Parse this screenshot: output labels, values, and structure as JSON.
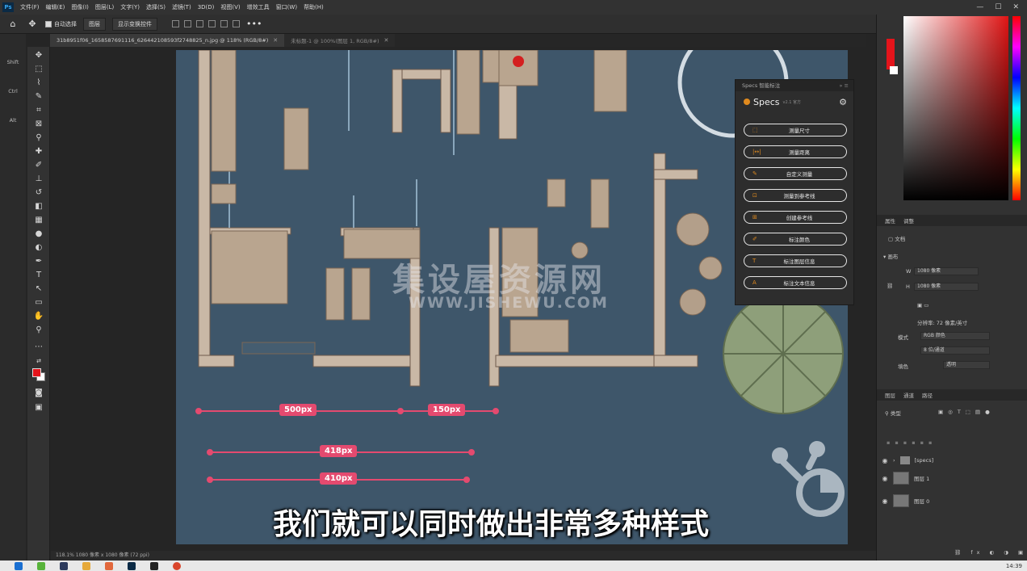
{
  "menu": {
    "app_icon": "Ps",
    "items": [
      "文件(F)",
      "编辑(E)",
      "图像(I)",
      "图层(L)",
      "文字(Y)",
      "选择(S)",
      "滤镜(T)",
      "3D(D)",
      "视图(V)",
      "增效工具",
      "窗口(W)",
      "帮助(H)"
    ]
  },
  "options": {
    "auto_select": "自动选择",
    "layer_select": "图层",
    "transform": "显示变换控件",
    "more": "•••"
  },
  "tabs": [
    {
      "label": "31b8951f06_1658587691116_626442108593f2748825_n.jpg @ 118% (RGB/8#)",
      "active": true
    },
    {
      "label": "未标题-1 @ 100%(图层 1, RGB/8#)",
      "active": false
    }
  ],
  "keys": [
    "Shift",
    "Ctrl",
    "Alt"
  ],
  "dimensions": [
    "500px",
    "150px",
    "418px",
    "410px"
  ],
  "watermark": {
    "cn": "集设屋资源网",
    "url": "WWW.JISHEWU.COM"
  },
  "subtitle": "我们就可以同时做出非常多种样式",
  "specs": {
    "header": "Specs 智能标注",
    "name": "Specs",
    "version": "v2.1 官方",
    "buttons": [
      {
        "icon": "⬚",
        "label": "测量尺寸"
      },
      {
        "icon": "|↔|",
        "label": "测量距离"
      },
      {
        "icon": "✎",
        "label": "自定义测量"
      },
      {
        "icon": "⊡",
        "label": "测量到参考线"
      },
      {
        "icon": "⊞",
        "label": "创建参考线"
      },
      {
        "icon": "✐",
        "label": "标注颜色"
      },
      {
        "icon": "T",
        "label": "标注图层信息"
      },
      {
        "icon": "A",
        "label": "标注文本信息"
      }
    ]
  },
  "properties": {
    "tabs": [
      "属性",
      "调整"
    ],
    "doc_label": "文档",
    "canvas_label": "画布",
    "width": "1080 像素",
    "height": "1080 像素",
    "resolution": "分辨率: 72 像素/英寸",
    "mode_label": "模式",
    "mode_value": "RGB 颜色",
    "depth_value": "8 位/通道",
    "fill_label": "填色",
    "fill_value": "透明"
  },
  "layers": {
    "tabs": [
      "图层",
      "通道",
      "路径"
    ],
    "filter": "类型",
    "items": [
      {
        "name": "[specs]",
        "type": "group"
      },
      {
        "name": "图层 1",
        "type": "layer"
      },
      {
        "name": "图层 0",
        "type": "layer"
      }
    ]
  },
  "status": "118.1%    1080 像素 x 1080 像素 (72 ppi)",
  "clock": "14:39",
  "colors": {
    "foreground": "#e4141b",
    "background": "#ffffff",
    "accent": "#e44a6f"
  }
}
